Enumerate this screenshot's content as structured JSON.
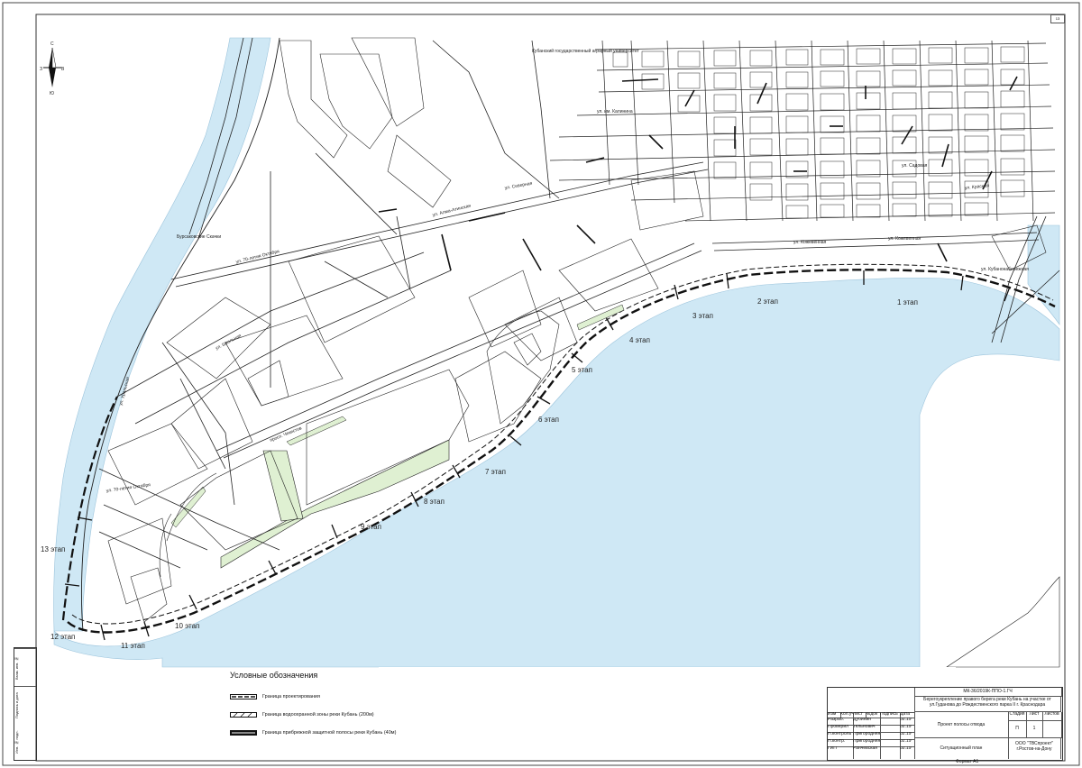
{
  "colors": {
    "water": "#cfe8f5",
    "greenery": "#dff0d2",
    "line": "#222222",
    "background": "#ffffff"
  },
  "compass": {
    "north": "С",
    "south": "Ю",
    "east": "В",
    "west": "З"
  },
  "map_labels": {
    "university": "Кубанский государственный аграрный университет",
    "pond": "Бурсаковские Скачки",
    "street_krasnaya": "ул. Красная",
    "street_kaliniina": "ул. им. Калинина",
    "street_alma_atinskaya": "ул. Алма-Атинская",
    "street_70_october": "ул. 70-летия Октября",
    "street_kozhevennaya": "ул. Кожевенная",
    "street_shkolnaya": "ул. Школьная",
    "street_chekistov": "просп. Чекистов",
    "street_kubanonaberezhnaya": "ул. Кубанонабережная",
    "street_sadovaya": "ул. Садовая",
    "street_severnaya": "ул. Северная",
    "street_uralskaya": "ул. Уральская"
  },
  "stages": [
    "1 этап",
    "2 этап",
    "3 этап",
    "4 этап",
    "5 этап",
    "6 этап",
    "7 этап",
    "8 этап",
    "9 этап",
    "10 этап",
    "11 этап",
    "12 этап",
    "13 этап"
  ],
  "legend": {
    "title": "Условные обозначения",
    "items": [
      "Граница проектирования",
      "Граница водоохранной зоны реки Кубань (200м)",
      "Граница прибрежной защитной полосы реки Кубань (40м)"
    ]
  },
  "title_block": {
    "code": "МК-36/2019К-ППО-1.ГЧ",
    "project": "Берегоукрепление правого берега реки Кубань на участке от ул.Гуданова до Рождественского парка II г. Краснодара",
    "roles": [
      "Разраб.",
      "Проверил",
      "Н.контроль",
      "Н.контр.",
      "ГИП"
    ],
    "names": [
      "Дубинин",
      "Тельнович",
      "Пригородняя",
      "Пригородняя",
      "Ранчевская"
    ],
    "dates": [
      "02.19",
      "02.19",
      "02.19",
      "02.19",
      "02.19"
    ],
    "sheet_title": "Проект полосы отвода",
    "drawing_title": "Ситуационный план",
    "stage_header": "Стадия",
    "sheet_header": "Лист",
    "sheets_header": "Листов",
    "stage_value": "П",
    "sheet_value": "1",
    "org": "ООО \"ТВСпроект\" г.Ростов-на-Дону",
    "column_headers": [
      "Изм",
      "Кол.уч",
      "Лист",
      "№док",
      "Подпись",
      "Дата"
    ]
  },
  "format_label": "Формат А1",
  "sheet_number": "13",
  "stamp_labels": [
    "Инв. № подл.",
    "Подпись и дата",
    "Взам. инв. №"
  ]
}
